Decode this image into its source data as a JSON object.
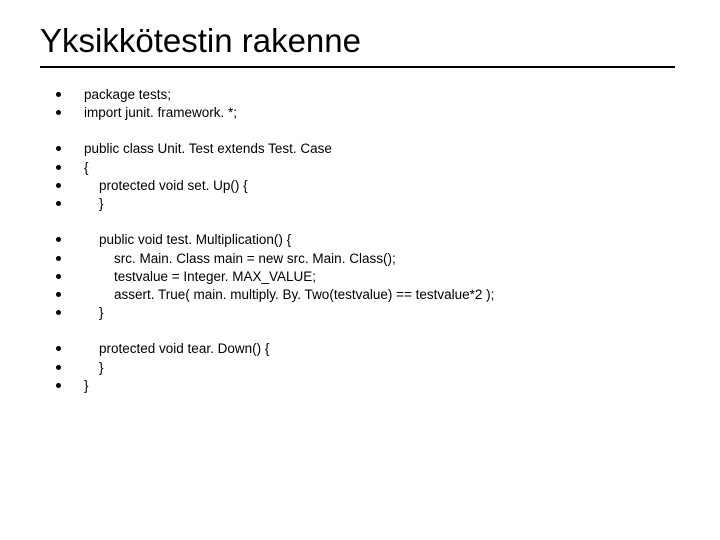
{
  "title": "Yksikkötestin rakenne",
  "groups": [
    [
      "package tests;",
      "import junit. framework. *;"
    ],
    [
      "public class Unit. Test extends Test. Case",
      "{",
      "    protected void set. Up() {",
      "    }"
    ],
    [
      "    public void test. Multiplication() {",
      "        src. Main. Class main = new src. Main. Class();",
      "        testvalue = Integer. MAX_VALUE;",
      "        assert. True( main. multiply. By. Two(testvalue) == testvalue*2 );",
      "    }"
    ],
    [
      "    protected void tear. Down() {",
      "    }",
      "}"
    ]
  ]
}
